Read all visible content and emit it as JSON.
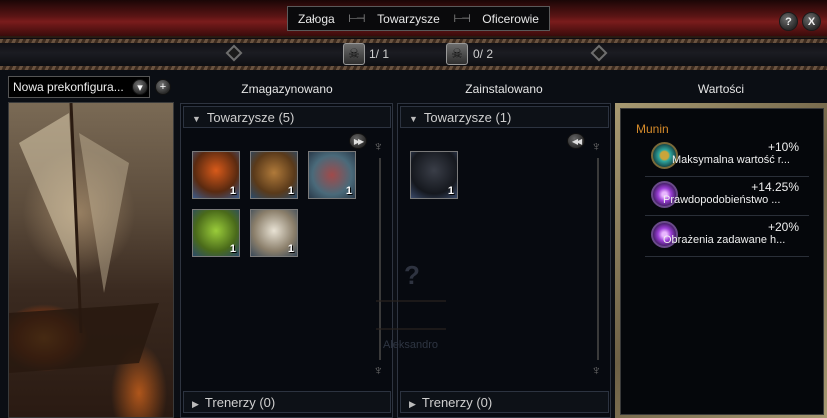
{
  "header": {
    "tabs": [
      {
        "label": "Załoga"
      },
      {
        "label": "Towarzysze",
        "active": true
      },
      {
        "label": "Oficerowie"
      }
    ],
    "help_label": "?",
    "close_label": "X"
  },
  "counters": [
    {
      "icon": "skull-crossed-icon",
      "value": "1/ 1"
    },
    {
      "icon": "skull-crossbones-icon",
      "value": "0/ 2"
    }
  ],
  "preset": {
    "label": "Nowa prekonfigura...",
    "dropdown_glyph": "▾",
    "add_glyph": "+"
  },
  "stored": {
    "header": "Zmagazynowano",
    "groups": [
      {
        "label": "Towarzysze (5)",
        "expanded": true
      },
      {
        "label": "Trenerzy (0)",
        "expanded": false
      }
    ],
    "items": [
      {
        "name": "volcano-companion",
        "count": "1"
      },
      {
        "name": "monkey-companion",
        "count": "1"
      },
      {
        "name": "turtle-companion",
        "count": "1"
      },
      {
        "name": "parrot-companion",
        "count": "1"
      },
      {
        "name": "owl-companion",
        "count": "1"
      }
    ]
  },
  "installed": {
    "header": "Zainstalowano",
    "groups": [
      {
        "label": "Towarzysze (1)",
        "expanded": true
      },
      {
        "label": "Trenerzy (0)",
        "expanded": false
      }
    ],
    "items": [
      {
        "name": "raven-companion",
        "count": "1"
      }
    ],
    "placeholder_glyph": "?",
    "placeholder_name": "Aleksandro"
  },
  "values": {
    "header": "Wartości",
    "owner": "Munin",
    "rows": [
      {
        "percent": "+10%",
        "label": "Maksymalna wartość r...",
        "icon": "compass-icon",
        "color": "#2fa8a0"
      },
      {
        "percent": "+14.25%",
        "label": "Prawdopodobieństwo ...",
        "icon": "gem-icon",
        "color": "#9b3fd6"
      },
      {
        "percent": "+20%",
        "label": "Obrażenia zadawane h...",
        "icon": "gem-icon",
        "color": "#9b3fd6"
      }
    ]
  },
  "colors": {
    "banner": "#7a1c1c",
    "owner": "#d58a2a",
    "frame": "#a89a72"
  }
}
